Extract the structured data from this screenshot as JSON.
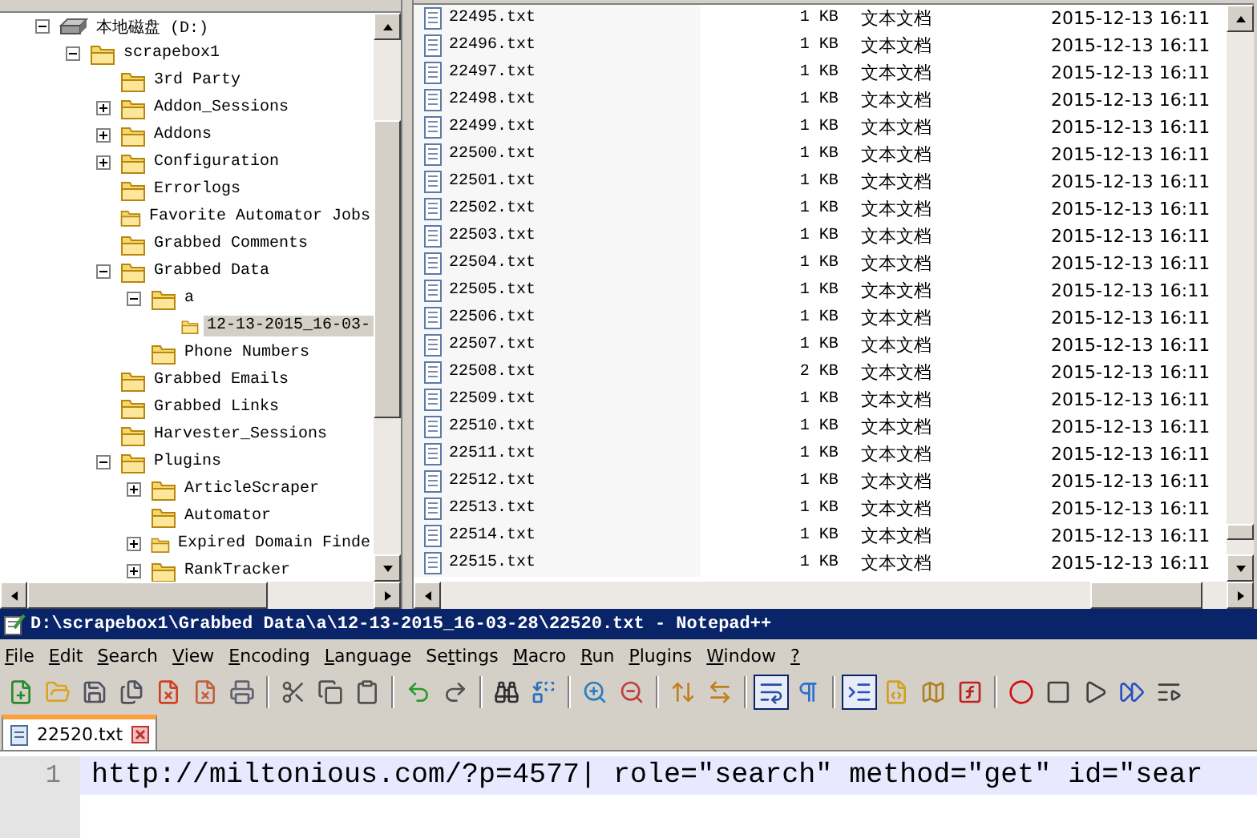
{
  "explorer": {
    "tree": [
      {
        "label": "本地磁盘 (D:)",
        "kind": "drive",
        "expanded": true,
        "selected": false,
        "children": [
          {
            "label": "scrapebox1",
            "kind": "folder",
            "expanded": true,
            "selected": false,
            "children": [
              {
                "label": "3rd Party",
                "kind": "folder",
                "selected": false
              },
              {
                "label": "Addon_Sessions",
                "kind": "folder",
                "expanded": false,
                "selected": false
              },
              {
                "label": "Addons",
                "kind": "folder",
                "expanded": false,
                "selected": false
              },
              {
                "label": "Configuration",
                "kind": "folder",
                "expanded": false,
                "selected": false
              },
              {
                "label": "Errorlogs",
                "kind": "folder",
                "selected": false
              },
              {
                "label": "Favorite Automator Jobs",
                "kind": "folder",
                "selected": false
              },
              {
                "label": "Grabbed Comments",
                "kind": "folder",
                "selected": false
              },
              {
                "label": "Grabbed Data",
                "kind": "folder",
                "expanded": true,
                "selected": false,
                "children": [
                  {
                    "label": "a",
                    "kind": "folder",
                    "expanded": true,
                    "selected": false,
                    "children": [
                      {
                        "label": "12-13-2015_16-03-",
                        "kind": "folder",
                        "selected": true
                      }
                    ]
                  },
                  {
                    "label": "Phone Numbers",
                    "kind": "folder",
                    "selected": false
                  }
                ]
              },
              {
                "label": "Grabbed Emails",
                "kind": "folder",
                "selected": false
              },
              {
                "label": "Grabbed Links",
                "kind": "folder",
                "selected": false
              },
              {
                "label": "Harvester_Sessions",
                "kind": "folder",
                "selected": false
              },
              {
                "label": "Plugins",
                "kind": "folder",
                "expanded": true,
                "selected": false,
                "children": [
                  {
                    "label": "ArticleScraper",
                    "kind": "folder",
                    "expanded": false,
                    "selected": false
                  },
                  {
                    "label": "Automator",
                    "kind": "folder",
                    "selected": false
                  },
                  {
                    "label": "Expired Domain Finde",
                    "kind": "folder",
                    "expanded": false,
                    "selected": false
                  },
                  {
                    "label": "RankTracker",
                    "kind": "folder",
                    "expanded": false,
                    "selected": false
                  }
                ]
              }
            ]
          }
        ]
      }
    ]
  },
  "file_list": {
    "rows": [
      {
        "name": "22495.txt",
        "size": "1 KB",
        "type": "文本文档",
        "modified": "2015-12-13 16:11"
      },
      {
        "name": "22496.txt",
        "size": "1 KB",
        "type": "文本文档",
        "modified": "2015-12-13 16:11"
      },
      {
        "name": "22497.txt",
        "size": "1 KB",
        "type": "文本文档",
        "modified": "2015-12-13 16:11"
      },
      {
        "name": "22498.txt",
        "size": "1 KB",
        "type": "文本文档",
        "modified": "2015-12-13 16:11"
      },
      {
        "name": "22499.txt",
        "size": "1 KB",
        "type": "文本文档",
        "modified": "2015-12-13 16:11"
      },
      {
        "name": "22500.txt",
        "size": "1 KB",
        "type": "文本文档",
        "modified": "2015-12-13 16:11"
      },
      {
        "name": "22501.txt",
        "size": "1 KB",
        "type": "文本文档",
        "modified": "2015-12-13 16:11"
      },
      {
        "name": "22502.txt",
        "size": "1 KB",
        "type": "文本文档",
        "modified": "2015-12-13 16:11"
      },
      {
        "name": "22503.txt",
        "size": "1 KB",
        "type": "文本文档",
        "modified": "2015-12-13 16:11"
      },
      {
        "name": "22504.txt",
        "size": "1 KB",
        "type": "文本文档",
        "modified": "2015-12-13 16:11"
      },
      {
        "name": "22505.txt",
        "size": "1 KB",
        "type": "文本文档",
        "modified": "2015-12-13 16:11"
      },
      {
        "name": "22506.txt",
        "size": "1 KB",
        "type": "文本文档",
        "modified": "2015-12-13 16:11"
      },
      {
        "name": "22507.txt",
        "size": "1 KB",
        "type": "文本文档",
        "modified": "2015-12-13 16:11"
      },
      {
        "name": "22508.txt",
        "size": "2 KB",
        "type": "文本文档",
        "modified": "2015-12-13 16:11"
      },
      {
        "name": "22509.txt",
        "size": "1 KB",
        "type": "文本文档",
        "modified": "2015-12-13 16:11"
      },
      {
        "name": "22510.txt",
        "size": "1 KB",
        "type": "文本文档",
        "modified": "2015-12-13 16:11"
      },
      {
        "name": "22511.txt",
        "size": "1 KB",
        "type": "文本文档",
        "modified": "2015-12-13 16:11"
      },
      {
        "name": "22512.txt",
        "size": "1 KB",
        "type": "文本文档",
        "modified": "2015-12-13 16:11"
      },
      {
        "name": "22513.txt",
        "size": "1 KB",
        "type": "文本文档",
        "modified": "2015-12-13 16:11"
      },
      {
        "name": "22514.txt",
        "size": "1 KB",
        "type": "文本文档",
        "modified": "2015-12-13 16:11"
      },
      {
        "name": "22515.txt",
        "size": "1 KB",
        "type": "文本文档",
        "modified": "2015-12-13 16:11"
      }
    ]
  },
  "notepad": {
    "title": "D:\\scrapebox1\\Grabbed Data\\a\\12-13-2015_16-03-28\\22520.txt - Notepad++",
    "menu": [
      {
        "key": "F",
        "post": "ile"
      },
      {
        "key": "E",
        "post": "dit"
      },
      {
        "key": "S",
        "post": "earch"
      },
      {
        "key": "V",
        "post": "iew"
      },
      {
        "key": "E",
        "post": "ncoding"
      },
      {
        "key": "L",
        "post": "anguage"
      },
      {
        "pre": "Se",
        "key": "t",
        "post": "tings"
      },
      {
        "key": "M",
        "post": "acro"
      },
      {
        "key": "R",
        "post": "un"
      },
      {
        "key": "P",
        "post": "lugins"
      },
      {
        "key": "W",
        "post": "indow"
      },
      {
        "key": "?"
      }
    ],
    "toolbar": [
      {
        "kind": "new",
        "pressed": false
      },
      {
        "kind": "open",
        "pressed": false
      },
      {
        "kind": "save",
        "pressed": false
      },
      {
        "kind": "save-all",
        "pressed": false
      },
      {
        "kind": "close",
        "pressed": false
      },
      {
        "kind": "close-all",
        "pressed": false
      },
      {
        "kind": "print",
        "pressed": false
      },
      {
        "kind": "sep"
      },
      {
        "kind": "cut",
        "pressed": false
      },
      {
        "kind": "copy",
        "pressed": false
      },
      {
        "kind": "paste",
        "pressed": false
      },
      {
        "kind": "sep"
      },
      {
        "kind": "undo",
        "pressed": false
      },
      {
        "kind": "redo",
        "pressed": false
      },
      {
        "kind": "sep"
      },
      {
        "kind": "find",
        "pressed": false
      },
      {
        "kind": "replace",
        "pressed": false
      },
      {
        "kind": "sep"
      },
      {
        "kind": "zoom-in",
        "pressed": false
      },
      {
        "kind": "zoom-out",
        "pressed": false
      },
      {
        "kind": "sep"
      },
      {
        "kind": "sync-vertical",
        "pressed": false
      },
      {
        "kind": "sync-horizontal",
        "pressed": false
      },
      {
        "kind": "sep"
      },
      {
        "kind": "word-wrap",
        "pressed": true
      },
      {
        "kind": "all-characters",
        "pressed": false
      },
      {
        "kind": "sep"
      },
      {
        "kind": "indent-guide",
        "pressed": true
      },
      {
        "kind": "language",
        "pressed": false
      },
      {
        "kind": "document-map",
        "pressed": false
      },
      {
        "kind": "function-list",
        "pressed": false
      },
      {
        "kind": "sep"
      },
      {
        "kind": "record",
        "pressed": false
      },
      {
        "kind": "stop",
        "pressed": false
      },
      {
        "kind": "play",
        "pressed": false
      },
      {
        "kind": "play-multiple",
        "pressed": false
      },
      {
        "kind": "save-macro",
        "pressed": false
      }
    ],
    "tabs": [
      {
        "label": "22520.txt",
        "selected": true
      }
    ],
    "editor": {
      "lines": [
        {
          "number": "1",
          "text": "http://miltonious.com/?p=4577| role=\"search\" method=\"get\" id=\"sear",
          "current": true
        }
      ]
    }
  }
}
